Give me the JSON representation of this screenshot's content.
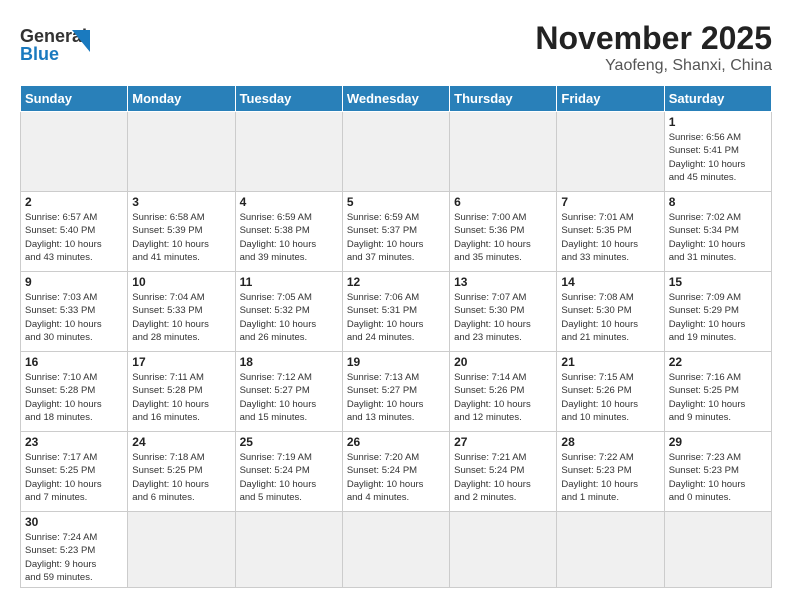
{
  "header": {
    "logo_general": "General",
    "logo_blue": "Blue",
    "month_year": "November 2025",
    "location": "Yaofeng, Shanxi, China"
  },
  "weekdays": [
    "Sunday",
    "Monday",
    "Tuesday",
    "Wednesday",
    "Thursday",
    "Friday",
    "Saturday"
  ],
  "weeks": [
    [
      {
        "day": "",
        "info": ""
      },
      {
        "day": "",
        "info": ""
      },
      {
        "day": "",
        "info": ""
      },
      {
        "day": "",
        "info": ""
      },
      {
        "day": "",
        "info": ""
      },
      {
        "day": "",
        "info": ""
      },
      {
        "day": "1",
        "info": "Sunrise: 6:56 AM\nSunset: 5:41 PM\nDaylight: 10 hours\nand 45 minutes."
      }
    ],
    [
      {
        "day": "2",
        "info": "Sunrise: 6:57 AM\nSunset: 5:40 PM\nDaylight: 10 hours\nand 43 minutes."
      },
      {
        "day": "3",
        "info": "Sunrise: 6:58 AM\nSunset: 5:39 PM\nDaylight: 10 hours\nand 41 minutes."
      },
      {
        "day": "4",
        "info": "Sunrise: 6:59 AM\nSunset: 5:38 PM\nDaylight: 10 hours\nand 39 minutes."
      },
      {
        "day": "5",
        "info": "Sunrise: 6:59 AM\nSunset: 5:37 PM\nDaylight: 10 hours\nand 37 minutes."
      },
      {
        "day": "6",
        "info": "Sunrise: 7:00 AM\nSunset: 5:36 PM\nDaylight: 10 hours\nand 35 minutes."
      },
      {
        "day": "7",
        "info": "Sunrise: 7:01 AM\nSunset: 5:35 PM\nDaylight: 10 hours\nand 33 minutes."
      },
      {
        "day": "8",
        "info": "Sunrise: 7:02 AM\nSunset: 5:34 PM\nDaylight: 10 hours\nand 31 minutes."
      }
    ],
    [
      {
        "day": "9",
        "info": "Sunrise: 7:03 AM\nSunset: 5:33 PM\nDaylight: 10 hours\nand 30 minutes."
      },
      {
        "day": "10",
        "info": "Sunrise: 7:04 AM\nSunset: 5:33 PM\nDaylight: 10 hours\nand 28 minutes."
      },
      {
        "day": "11",
        "info": "Sunrise: 7:05 AM\nSunset: 5:32 PM\nDaylight: 10 hours\nand 26 minutes."
      },
      {
        "day": "12",
        "info": "Sunrise: 7:06 AM\nSunset: 5:31 PM\nDaylight: 10 hours\nand 24 minutes."
      },
      {
        "day": "13",
        "info": "Sunrise: 7:07 AM\nSunset: 5:30 PM\nDaylight: 10 hours\nand 23 minutes."
      },
      {
        "day": "14",
        "info": "Sunrise: 7:08 AM\nSunset: 5:30 PM\nDaylight: 10 hours\nand 21 minutes."
      },
      {
        "day": "15",
        "info": "Sunrise: 7:09 AM\nSunset: 5:29 PM\nDaylight: 10 hours\nand 19 minutes."
      }
    ],
    [
      {
        "day": "16",
        "info": "Sunrise: 7:10 AM\nSunset: 5:28 PM\nDaylight: 10 hours\nand 18 minutes."
      },
      {
        "day": "17",
        "info": "Sunrise: 7:11 AM\nSunset: 5:28 PM\nDaylight: 10 hours\nand 16 minutes."
      },
      {
        "day": "18",
        "info": "Sunrise: 7:12 AM\nSunset: 5:27 PM\nDaylight: 10 hours\nand 15 minutes."
      },
      {
        "day": "19",
        "info": "Sunrise: 7:13 AM\nSunset: 5:27 PM\nDaylight: 10 hours\nand 13 minutes."
      },
      {
        "day": "20",
        "info": "Sunrise: 7:14 AM\nSunset: 5:26 PM\nDaylight: 10 hours\nand 12 minutes."
      },
      {
        "day": "21",
        "info": "Sunrise: 7:15 AM\nSunset: 5:26 PM\nDaylight: 10 hours\nand 10 minutes."
      },
      {
        "day": "22",
        "info": "Sunrise: 7:16 AM\nSunset: 5:25 PM\nDaylight: 10 hours\nand 9 minutes."
      }
    ],
    [
      {
        "day": "23",
        "info": "Sunrise: 7:17 AM\nSunset: 5:25 PM\nDaylight: 10 hours\nand 7 minutes."
      },
      {
        "day": "24",
        "info": "Sunrise: 7:18 AM\nSunset: 5:25 PM\nDaylight: 10 hours\nand 6 minutes."
      },
      {
        "day": "25",
        "info": "Sunrise: 7:19 AM\nSunset: 5:24 PM\nDaylight: 10 hours\nand 5 minutes."
      },
      {
        "day": "26",
        "info": "Sunrise: 7:20 AM\nSunset: 5:24 PM\nDaylight: 10 hours\nand 4 minutes."
      },
      {
        "day": "27",
        "info": "Sunrise: 7:21 AM\nSunset: 5:24 PM\nDaylight: 10 hours\nand 2 minutes."
      },
      {
        "day": "28",
        "info": "Sunrise: 7:22 AM\nSunset: 5:23 PM\nDaylight: 10 hours\nand 1 minute."
      },
      {
        "day": "29",
        "info": "Sunrise: 7:23 AM\nSunset: 5:23 PM\nDaylight: 10 hours\nand 0 minutes."
      }
    ],
    [
      {
        "day": "30",
        "info": "Sunrise: 7:24 AM\nSunset: 5:23 PM\nDaylight: 9 hours\nand 59 minutes."
      },
      {
        "day": "",
        "info": ""
      },
      {
        "day": "",
        "info": ""
      },
      {
        "day": "",
        "info": ""
      },
      {
        "day": "",
        "info": ""
      },
      {
        "day": "",
        "info": ""
      },
      {
        "day": "",
        "info": ""
      }
    ]
  ]
}
